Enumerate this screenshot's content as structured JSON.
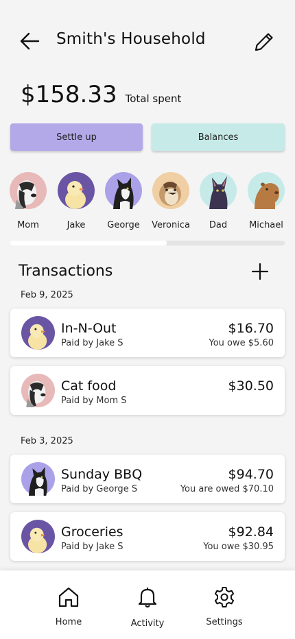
{
  "header": {
    "title": "Smith's Household",
    "back_icon": "arrow-left-icon",
    "edit_icon": "pencil-icon"
  },
  "summary": {
    "total_amount": "$158.33",
    "total_label": "Total spent"
  },
  "actions": {
    "settle_label": "Settle up",
    "balances_label": "Balances",
    "settle_color": "#b3a9e8",
    "balances_color": "#c6eae8"
  },
  "members": [
    {
      "name": "Mom",
      "animal": "badger",
      "bg": "#e8b9b9"
    },
    {
      "name": "Jake",
      "animal": "chick",
      "bg": "#6a55a5"
    },
    {
      "name": "George",
      "animal": "cat",
      "bg": "#aaa1e8"
    },
    {
      "name": "Veronica",
      "animal": "chipmunk",
      "bg": "#f0cfa4"
    },
    {
      "name": "Dad",
      "animal": "black-cat",
      "bg": "#c6eae8"
    },
    {
      "name": "Michael",
      "animal": "capybara",
      "bg": "#c6eae8"
    }
  ],
  "members_scroll_fraction": 0.57,
  "transactions": {
    "title": "Transactions",
    "groups": [
      {
        "date": "Feb 9, 2025",
        "items": [
          {
            "name": "In-N-Out",
            "paid_by": "Paid by Jake S",
            "amount": "$16.70",
            "status": "You owe $5.60"
          },
          {
            "name": "Cat food",
            "paid_by": "Paid by Mom S",
            "amount": "$30.50",
            "status": ""
          }
        ]
      },
      {
        "date": "Feb 3, 2025",
        "items": [
          {
            "name": "Sunday BBQ",
            "paid_by": "Paid by George S",
            "amount": "$94.70",
            "status": "You are owed $70.10"
          },
          {
            "name": "Groceries",
            "paid_by": "Paid by Jake S",
            "amount": "$92.84",
            "status": "You owe $30.95"
          }
        ]
      }
    ]
  },
  "nav": [
    {
      "label": "Home",
      "icon": "home-icon"
    },
    {
      "label": "Activity",
      "icon": "bell-icon"
    },
    {
      "label": "Settings",
      "icon": "gear-icon"
    }
  ]
}
